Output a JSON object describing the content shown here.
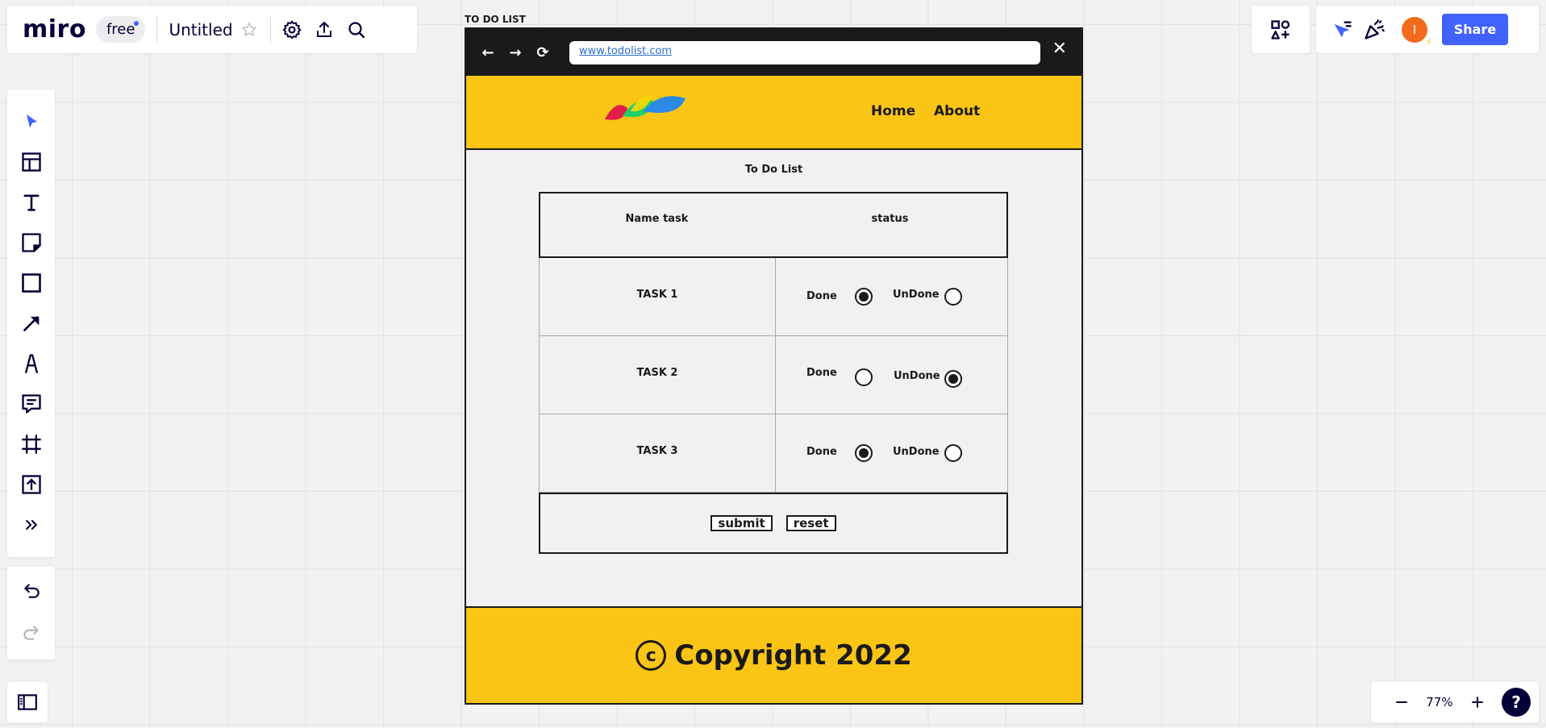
{
  "app": {
    "logo": "miro",
    "plan": "free",
    "board_title": "Untitled",
    "share_label": "Share",
    "avatar_initial": "I",
    "accent_color": "#4262ff"
  },
  "toolbar": {
    "tools": [
      "select-tool",
      "templates-tool",
      "text-tool",
      "sticky-note-tool",
      "shape-tool",
      "connection-line-tool",
      "pen-tool",
      "comment-tool",
      "frame-tool",
      "upload-tool",
      "more-tools"
    ]
  },
  "zoom": {
    "level": "77%",
    "help": "?"
  },
  "frame": {
    "label": "TO DO LIST",
    "browser": {
      "url": "www.todolist.com"
    },
    "nav": {
      "home": "Home",
      "about": "About"
    },
    "page_title": "To Do List",
    "table": {
      "headers": [
        "Name task",
        "status"
      ],
      "rows": [
        {
          "task": "TASK 1",
          "done_label": "Done",
          "undone_label": "UnDone",
          "status": "Done"
        },
        {
          "task": "TASK 2",
          "done_label": "Done",
          "undone_label": "UnDone",
          "status": "UnDone"
        },
        {
          "task": "TASK 3",
          "done_label": "Done",
          "undone_label": "UnDone",
          "status": "Done"
        }
      ],
      "submit_label": "submit",
      "reset_label": "reset"
    },
    "footer": {
      "copyright": "Copyright 2022"
    },
    "header_color": "#fac515"
  }
}
